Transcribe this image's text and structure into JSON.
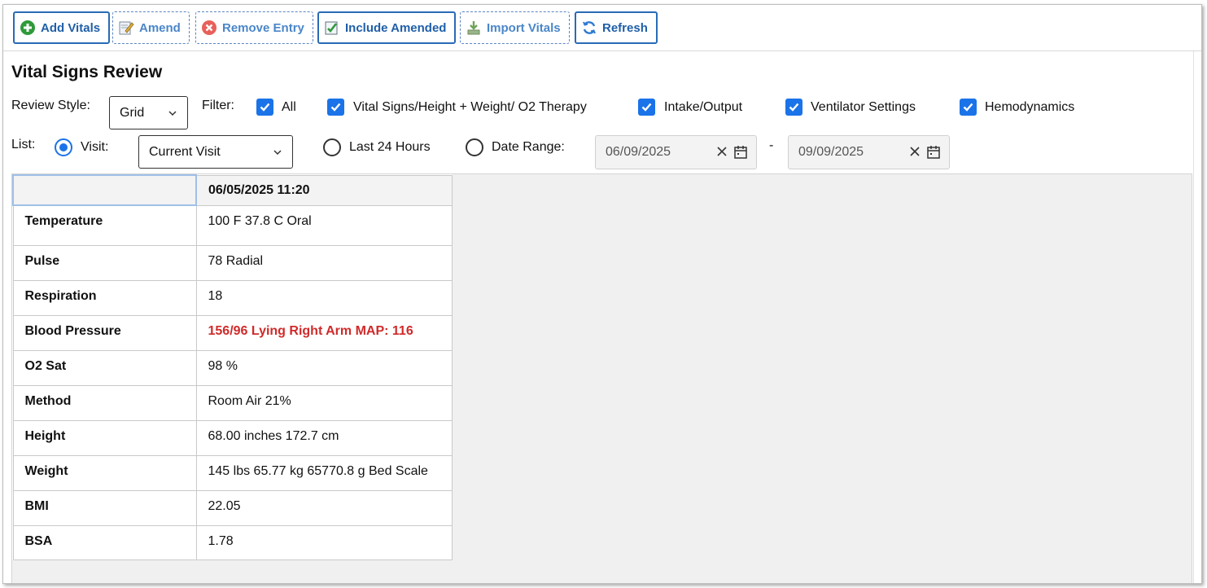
{
  "toolbar": {
    "add_vitals": "Add Vitals",
    "amend": "Amend",
    "remove_entry": "Remove Entry",
    "include_amended": "Include Amended",
    "import_vitals": "Import Vitals",
    "refresh": "Refresh"
  },
  "page": {
    "title": "Vital Signs Review"
  },
  "review_style": {
    "label": "Review Style:",
    "value": "Grid"
  },
  "filter": {
    "label": "Filter:",
    "options": [
      {
        "label": "All",
        "checked": true
      },
      {
        "label": "Vital Signs/Height + Weight/ O2 Therapy",
        "checked": true
      },
      {
        "label": "Intake/Output",
        "checked": true
      },
      {
        "label": "Ventilator Settings",
        "checked": true
      },
      {
        "label": "Hemodynamics",
        "checked": true
      }
    ]
  },
  "list": {
    "label": "List:",
    "visit_label": "Visit:",
    "visit_value": "Current Visit",
    "last24_label": "Last 24 Hours",
    "date_range_label": "Date Range:",
    "date_from": "06/09/2025",
    "separator": "-",
    "date_to": "09/09/2025"
  },
  "grid": {
    "column_header": "06/05/2025 11:20",
    "rows": [
      {
        "label": "Temperature",
        "value": "100 F 37.8 C Oral"
      },
      {
        "label": "Pulse",
        "value": "78 Radial"
      },
      {
        "label": "Respiration",
        "value": "18"
      },
      {
        "label": "Blood Pressure",
        "value": "156/96 Lying Right Arm MAP: 116",
        "alert": true
      },
      {
        "label": "O2 Sat",
        "value": "98 %"
      },
      {
        "label": "Method",
        "value": "Room Air 21%"
      },
      {
        "label": "Height",
        "value": "68.00 inches 172.7 cm"
      },
      {
        "label": "Weight",
        "value": "145 lbs 65.77 kg 65770.8 g Bed Scale"
      },
      {
        "label": "BMI",
        "value": "22.05"
      },
      {
        "label": "BSA",
        "value": "1.78"
      }
    ]
  },
  "colors": {
    "accent": "#1a73e8",
    "alert": "#d02a2a",
    "toolbar_text": "#1f5fa8"
  }
}
